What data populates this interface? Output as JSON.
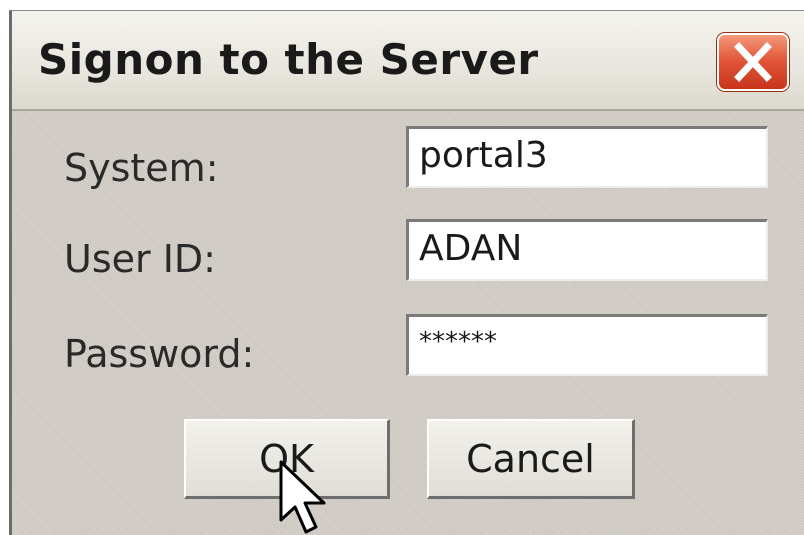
{
  "dialog": {
    "title": "Signon to the Server",
    "close_icon": "close-x-icon",
    "close_color": "#d8462a"
  },
  "form": {
    "system": {
      "label": "System:",
      "value": "portal3"
    },
    "user_id": {
      "label": "User ID:",
      "value": "ADAN"
    },
    "password": {
      "label": "Password:",
      "value": "******"
    }
  },
  "buttons": {
    "ok_label": "OK",
    "cancel_label": "Cancel"
  },
  "pointer": {
    "icon": "mouse-pointer-icon"
  }
}
